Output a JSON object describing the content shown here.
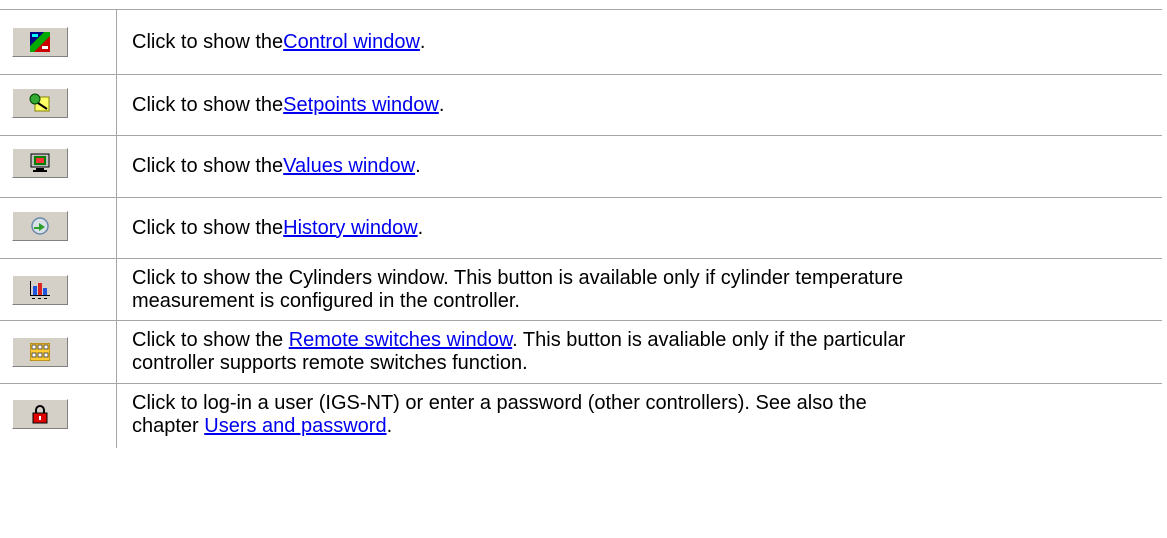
{
  "rows": [
    {
      "icon": "control-window-icon",
      "pre": "Click to show the ",
      "link": "Control window",
      "post": "."
    },
    {
      "icon": "setpoints-window-icon",
      "pre": "Click to show the ",
      "link": "Setpoints window",
      "post": "."
    },
    {
      "icon": "values-window-icon",
      "pre": "Click to show the ",
      "link": "Values window",
      "post": "."
    },
    {
      "icon": "history-window-icon",
      "pre": "Click to show the ",
      "link": "History window",
      "post": "."
    },
    {
      "icon": "cylinders-window-icon",
      "text_line1": "Click to show the Cylinders window. This button is available only if cylinder temperature",
      "text_line2": "measurement is configured in the controller."
    },
    {
      "icon": "remote-switches-icon",
      "pre": "Click to show the ",
      "link": "Remote switches window",
      "post": ". This button is avaliable only if the particular",
      "line2": "controller supports remote switches function."
    },
    {
      "icon": "lock-icon",
      "line1": "Click to log-in a user (IGS-NT) or enter a password (other controllers). See also the",
      "pre2": "chapter ",
      "link": "Users and password",
      "post2": "."
    }
  ],
  "colors": {
    "link": "#0000ee",
    "grid": "#a6a6a6",
    "button_face": "#d4d0c8"
  }
}
